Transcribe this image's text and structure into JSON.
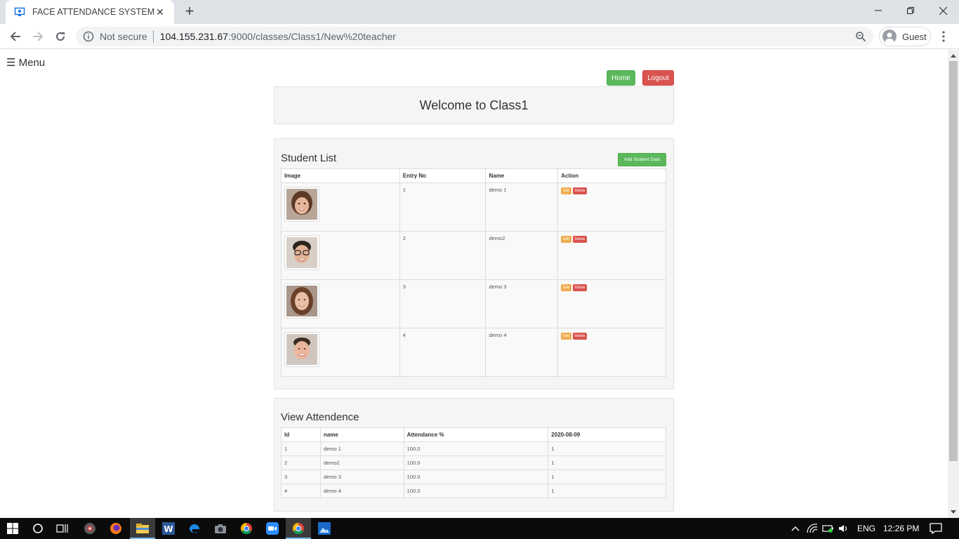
{
  "browser": {
    "tab_title": "FACE ATTENDANCE SYSTEM",
    "security_label": "Not secure",
    "url_host": "104.155.231.67",
    "url_path": ":9000/classes/Class1/New%20teacher",
    "profile_label": "Guest"
  },
  "page": {
    "menu_label": "☰ Menu",
    "home_button": "Home",
    "logout_button": "Logout",
    "welcome_title": "Welcome to Class1",
    "student_list": {
      "title": "Student List",
      "add_button": "Add Student Data",
      "columns": [
        "Image",
        "Entry No",
        "Name",
        "Action"
      ],
      "edit_label": "Edit",
      "delete_label": "Delete",
      "rows": [
        {
          "entry": "1",
          "name": "demo 1"
        },
        {
          "entry": "2",
          "name": "demo2"
        },
        {
          "entry": "3",
          "name": "demo 3"
        },
        {
          "entry": "4",
          "name": "demo 4"
        }
      ]
    },
    "attendance": {
      "title": "View Attendence",
      "columns": [
        "Id",
        "name",
        "Attendance %",
        "2020-08-09"
      ],
      "rows": [
        [
          "1",
          "demo 1",
          "100.0",
          "1"
        ],
        [
          "2",
          "demo2",
          "100.0",
          "1"
        ],
        [
          "3",
          "demo 3",
          "100.0",
          "1"
        ],
        [
          "4",
          "demo 4",
          "100.0",
          "1"
        ]
      ]
    }
  },
  "taskbar": {
    "language": "ENG",
    "time": "12:26 PM"
  },
  "colors": {
    "success": "#5cb85c",
    "danger": "#d9534f",
    "warning": "#f0ad4e",
    "panel_bg": "#f5f5f5"
  }
}
